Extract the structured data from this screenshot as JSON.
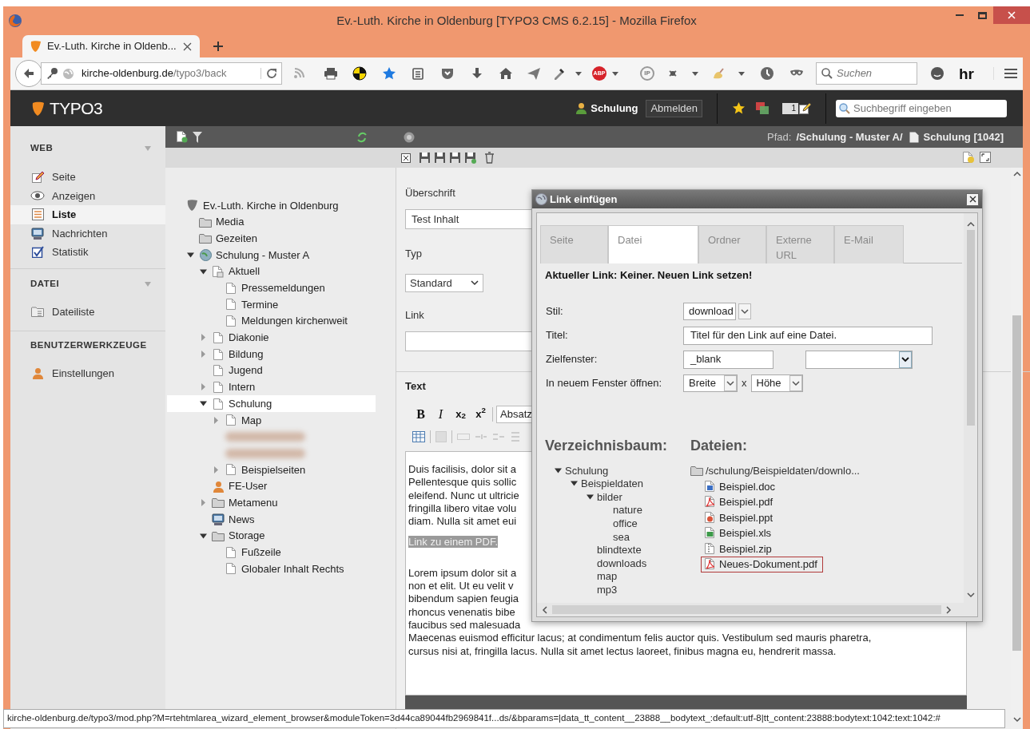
{
  "window": {
    "title": "Ev.-Luth. Kirche in Oldenburg [TYPO3 CMS 6.2.15] - Mozilla Firefox"
  },
  "browser_tabs": [
    {
      "label": "Ev.-Luth. Kirche in Oldenb...",
      "selected": true
    }
  ],
  "address_bar": {
    "domain": "kirche-oldenburg.de",
    "path": "/typo3/back"
  },
  "toolbar_labels": {
    "adblock": "ABP",
    "ip": "IP",
    "profile": "hr"
  },
  "browser_search": {
    "placeholder": "Suchen"
  },
  "typo3_bar": {
    "logo": "TYPO3",
    "user": "Schulung",
    "logout": "Abmelden",
    "badge": "1",
    "search_placeholder": "Suchbegriff eingeben"
  },
  "modules": [
    {
      "heading": "WEB",
      "collapsible": true,
      "items": [
        {
          "label": "Seite",
          "kind": "edit",
          "selected": false
        },
        {
          "label": "Anzeigen",
          "kind": "eye",
          "selected": false
        },
        {
          "label": "Liste",
          "kind": "list",
          "selected": true
        },
        {
          "label": "Nachrichten",
          "kind": "news",
          "selected": false
        },
        {
          "label": "Statistik",
          "kind": "check",
          "selected": false
        }
      ]
    },
    {
      "heading": "DATEI",
      "collapsible": true,
      "items": [
        {
          "label": "Dateiliste",
          "kind": "files",
          "selected": false
        }
      ]
    },
    {
      "heading": "BENUTZERWERKZEUGE",
      "collapsible": false,
      "items": [
        {
          "label": "Einstellungen",
          "kind": "user",
          "selected": false
        }
      ]
    }
  ],
  "page_tree": {
    "label": "Ev.-Luth. Kirche in Oldenburg",
    "kind": "site",
    "selected": false,
    "children": [
      {
        "label": "Media",
        "kind": "folder",
        "selected": false
      },
      {
        "label": "Gezeiten",
        "kind": "folder",
        "selected": false
      },
      {
        "label": "Schulung - Muster A",
        "kind": "globe",
        "expanded": true,
        "selected": false,
        "children": [
          {
            "label": "Aktuell",
            "kind": "shortcut",
            "expanded": true,
            "selected": false,
            "children": [
              {
                "label": "Pressemeldungen",
                "kind": "page",
                "selected": false
              },
              {
                "label": "Termine",
                "kind": "page",
                "selected": false
              },
              {
                "label": "Meldungen kirchenweit",
                "kind": "page",
                "selected": false
              }
            ]
          },
          {
            "label": "Diakonie",
            "kind": "page",
            "expanded": false,
            "selected": false
          },
          {
            "label": "Bildung",
            "kind": "page",
            "expanded": false,
            "selected": false
          },
          {
            "label": "Jugend",
            "kind": "page",
            "selected": false
          },
          {
            "label": "Intern",
            "kind": "page",
            "expanded": false,
            "selected": false
          },
          {
            "label": "Schulung",
            "kind": "page",
            "expanded": true,
            "selected": true,
            "children": [
              {
                "label": "Map",
                "kind": "page",
                "expanded": false,
                "selected": false
              },
              {
                "kind": "redacted"
              },
              {
                "kind": "redacted"
              },
              {
                "label": "Beispielseiten",
                "kind": "page",
                "expanded": false,
                "selected": false
              }
            ]
          },
          {
            "label": "FE-User",
            "kind": "user",
            "selected": false
          },
          {
            "label": "Metamenu",
            "kind": "folder",
            "expanded": false,
            "selected": false
          },
          {
            "label": "News",
            "kind": "news",
            "selected": false
          },
          {
            "label": "Storage",
            "kind": "folder",
            "expanded": true,
            "selected": false,
            "children": [
              {
                "label": "Fußzeile",
                "kind": "page",
                "selected": false
              },
              {
                "label": "Globaler Inhalt Rechts",
                "kind": "page",
                "selected": false
              }
            ]
          }
        ]
      }
    ]
  },
  "doc_path": {
    "label": "Pfad:",
    "path": "/Schulung - Muster A/",
    "page": "Schulung [1042]"
  },
  "form": {
    "fields": [
      {
        "label": "Überschrift",
        "kind": "input",
        "value": "Test Inhalt"
      },
      {
        "label": "Typ",
        "kind": "select",
        "value": "Standard"
      },
      {
        "label": "Link",
        "kind": "input"
      }
    ]
  },
  "editor": {
    "label": "Text",
    "buttons": [
      "B",
      "I",
      "x$_{2}$",
      "x$^{2}$"
    ],
    "format": "Absatz",
    "paragraphs": [
      {
        "selected": false,
        "lines": [
          "Duis facilisis, dolor sit a",
          "Pellentesque quis sollic",
          "eleifend. Nunc ut ultricie",
          "fringilla libero vitae volu",
          "diam. Nulla sit amet eui"
        ]
      },
      {
        "selected": true,
        "lines": [
          "Link zu einem PDF."
        ]
      },
      {
        "selected": false,
        "lines": [
          "Lorem ipsum dolor sit a",
          "non et elit. Ut eu velit v",
          "bibendum sapien feugia",
          "rhoncus venenatis bibe",
          "faucibus sed malesuada",
          "Maecenas euismod efficitur lacus; at condimentum felis auctor quis. Vestibulum sed mauris pharetra,",
          "cursus nisi at, fringilla lacus. Nulla sit amet lectus laoreet, finibus magna eu, hendrerit massa."
        ]
      }
    ]
  },
  "dialog": {
    "title": "Link einfügen",
    "tabs": [
      {
        "label": "Seite",
        "selected": false
      },
      {
        "label": "Datei",
        "selected": true
      },
      {
        "label": "Ordner",
        "selected": false
      },
      {
        "label": "Externe URL",
        "selected": false
      },
      {
        "label": "E-Mail",
        "selected": false
      }
    ],
    "current_link": "Aktueller Link: Keiner. Neuen Link setzen!",
    "fields": [
      {
        "label": "Stil:",
        "kind": "select",
        "value": "download"
      },
      {
        "label": "Titel:",
        "kind": "input",
        "value": "Titel für den Link auf eine Datei."
      },
      {
        "label": "Zielfenster:",
        "kind": "target",
        "value": "_blank"
      },
      {
        "label": "In neuem Fenster öffnen:",
        "kind": "size",
        "width": "Breite",
        "separator": "x",
        "height": "Höhe"
      }
    ],
    "tree_heading": "Verzeichnisbaum:",
    "files_heading": "Dateien:",
    "tree": {
      "label": "Schulung",
      "expanded": true,
      "children": [
        {
          "label": "Beispieldaten",
          "expanded": true,
          "children": [
            {
              "label": "bilder",
              "expanded": true,
              "children": [
                {
                  "label": "nature"
                },
                {
                  "label": "office"
                },
                {
                  "label": "sea"
                }
              ]
            },
            {
              "label": "blindtexte"
            },
            {
              "label": "downloads"
            },
            {
              "label": "map"
            },
            {
              "label": "mp3"
            }
          ]
        }
      ]
    },
    "folder": "/schulung/Beispieldaten/downlo...",
    "files": [
      {
        "name": "Beispiel.doc",
        "kind": "doc",
        "selected": false
      },
      {
        "name": "Beispiel.pdf",
        "kind": "pdf",
        "selected": false
      },
      {
        "name": "Beispiel.ppt",
        "kind": "ppt",
        "selected": false
      },
      {
        "name": "Beispiel.xls",
        "kind": "xls",
        "selected": false
      },
      {
        "name": "Beispiel.zip",
        "kind": "zip",
        "selected": false
      },
      {
        "name": "Neues-Dokument.pdf",
        "kind": "pdf",
        "selected": true
      }
    ]
  },
  "status_bar": {
    "url": "kirche-oldenburg.de/typo3/mod.php?M=rtehtmlarea_wizard_element_browser&moduleToken=3d44ca89044fb2969841f...ds/&bparams=|data_tt_content__23888__bodytext_:default:utf-8|tt_content:23888:bodytext:1042:text:1042:#"
  }
}
